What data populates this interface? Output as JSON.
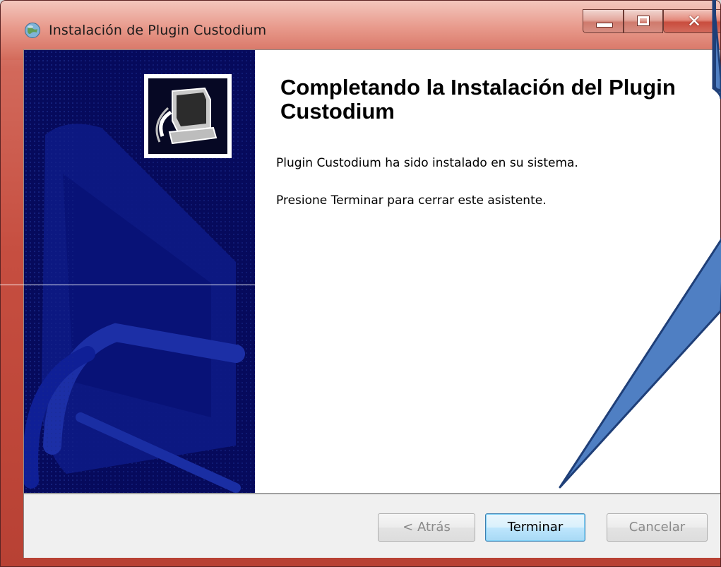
{
  "window": {
    "title": "Instalación de Plugin Custodium",
    "icon": "installer-globe-icon"
  },
  "content": {
    "heading": "Completando la Instalación del Plugin Custodium",
    "line1": "Plugin Custodium ha sido instalado en su sistema.",
    "line2": "Presione Terminar para cerrar este asistente."
  },
  "buttons": {
    "back": "< Atrás",
    "finish": "Terminar",
    "cancel": "Cancelar"
  },
  "colors": {
    "title_bar": "#d36a5a",
    "banner": "#060a5c",
    "callout": "#4f7fc3",
    "callout_border": "#1f3f78",
    "focused_button": "#3c7fb1"
  }
}
